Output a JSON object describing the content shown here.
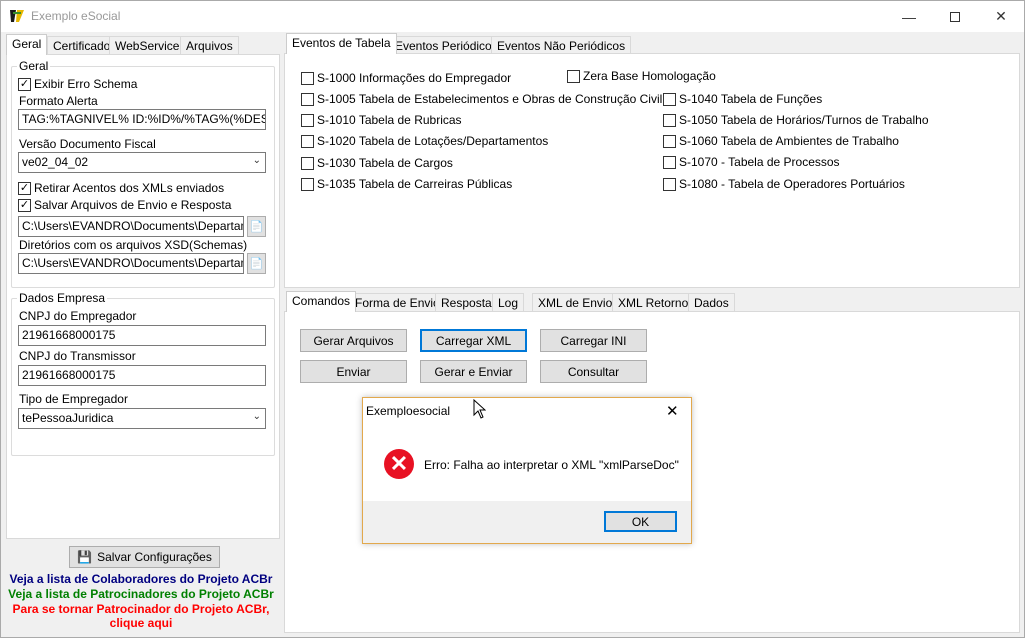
{
  "window": {
    "title": "Exemplo eSocial",
    "minimize_icon": "minimize-icon",
    "maximize_icon": "maximize-icon",
    "close_icon": "close-icon"
  },
  "left_tabs": [
    "Geral",
    "Certificado",
    "WebService",
    "Arquivos"
  ],
  "geral": {
    "legend": "Geral",
    "exibir_erro_schema": "Exibir Erro Schema",
    "formato_alerta_label": "Formato Alerta",
    "formato_alerta_value": "TAG:%TAGNIVEL% ID:%ID%/%TAG%(%DESCRICA",
    "versao_label": "Versão Documento Fiscal",
    "versao_value": "ve02_04_02",
    "retirar_acentos": "Retirar Acentos dos XMLs enviados",
    "salvar_arquivos": "Salvar Arquivos de Envio e Resposta",
    "path1_value": "C:\\Users\\EVANDRO\\Documents\\Departamer",
    "diretorios_label": "Diretórios com os arquivos XSD(Schemas)",
    "path2_value": "C:\\Users\\EVANDRO\\Documents\\Departamer"
  },
  "empresa": {
    "legend": "Dados Empresa",
    "cnpj_empregador_label": "CNPJ do Empregador",
    "cnpj_empregador_value": "21961668000175",
    "cnpj_transmissor_label": "CNPJ do Transmissor",
    "cnpj_transmissor_value": "21961668000175",
    "tipo_label": "Tipo de Empregador",
    "tipo_value": "tePessoaJuridica"
  },
  "salvar_button": "Salvar Configurações",
  "links": {
    "colaboradores": "Veja a lista de Colaboradores do Projeto ACBr",
    "patrocinadores": "Veja a lista de Patrocinadores do Projeto ACBr",
    "tornar_line1": "Para se tornar Patrocinador do Projeto ACBr,",
    "tornar_line2": "clique aqui",
    "color_blue": "#000080",
    "color_green": "#008000",
    "color_red": "#ff0000"
  },
  "top_tabs": [
    "Eventos de Tabela",
    "Eventos Periódicos",
    "Eventos Não Periódicos"
  ],
  "eventos": {
    "s1000": "S-1000 Informações do Empregador",
    "zera_base": "Zera Base Homologação",
    "s1005": "S-1005 Tabela de Estabelecimentos e Obras de Construção Civil",
    "s1010": "S-1010 Tabela de Rubricas",
    "s1020": "S-1020 Tabela de Lotações/Departamentos",
    "s1030": "S-1030 Tabela de Cargos",
    "s1035": "S-1035 Tabela de Carreiras Públicas",
    "s1040": "S-1040 Tabela de Funções",
    "s1050": "S-1050 Tabela de Horários/Turnos de Trabalho",
    "s1060": "S-1060 Tabela de Ambientes de Trabalho",
    "s1070": "S-1070 - Tabela de Processos",
    "s1080": "S-1080 - Tabela de Operadores Portuários"
  },
  "bottom_tabs": [
    "Comandos",
    "Forma de Envio",
    "Resposta",
    "Log",
    "XML de Envio",
    "XML Retorno",
    "Dados"
  ],
  "commands": {
    "gerar_arquivos": "Gerar Arquivos",
    "carregar_xml": "Carregar XML",
    "carregar_ini": "Carregar INI",
    "enviar": "Enviar",
    "gerar_enviar": "Gerar e Enviar",
    "consultar": "Consultar"
  },
  "dialog": {
    "title": "Exemploesocial",
    "message": "Erro: Falha ao interpretar o XML \"xmlParseDoc\"",
    "ok": "OK",
    "icon": "error-icon"
  }
}
